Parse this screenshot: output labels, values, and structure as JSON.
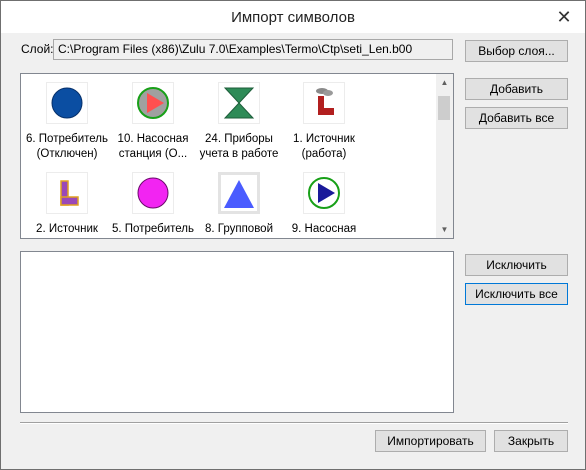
{
  "window": {
    "title": "Импорт символов",
    "close_glyph": "✕"
  },
  "layer": {
    "label": "Слой:",
    "path": "C:\\Program Files (x86)\\Zulu 7.0\\Examples\\Termo\\Ctp\\seti_Len.b00",
    "select_button": "Выбор слоя..."
  },
  "actions": {
    "add": "Добавить",
    "add_all": "Добавить все",
    "exclude": "Исключить",
    "exclude_all": "Исключить все"
  },
  "footer": {
    "import": "Импортировать",
    "close": "Закрыть"
  },
  "symbols": [
    {
      "label": "6. Потребитель (Отключен)",
      "icon": "consumer-off-icon"
    },
    {
      "label": "10. Насосная станция (О...",
      "icon": "pump-station-icon"
    },
    {
      "label": "24. Приборы учета в работе",
      "icon": "meter-icon"
    },
    {
      "label": "1. Источник (работа)",
      "icon": "source-working-icon"
    },
    {
      "label": "2. Источник",
      "icon": "source-icon"
    },
    {
      "label": "5. Потребитель",
      "icon": "consumer-icon"
    },
    {
      "label": "8. Групповой",
      "icon": "group-icon"
    },
    {
      "label": "9. Насосная",
      "icon": "pump-icon"
    }
  ],
  "colors": {
    "consumer_off": "#0b4ea2",
    "consumer": "#f224f2",
    "group": "#4a5cff",
    "meter": "#2e8b57",
    "source": "#b21f1f",
    "pump_green": "#18a018",
    "pump_blue": "#1a1a9a"
  }
}
